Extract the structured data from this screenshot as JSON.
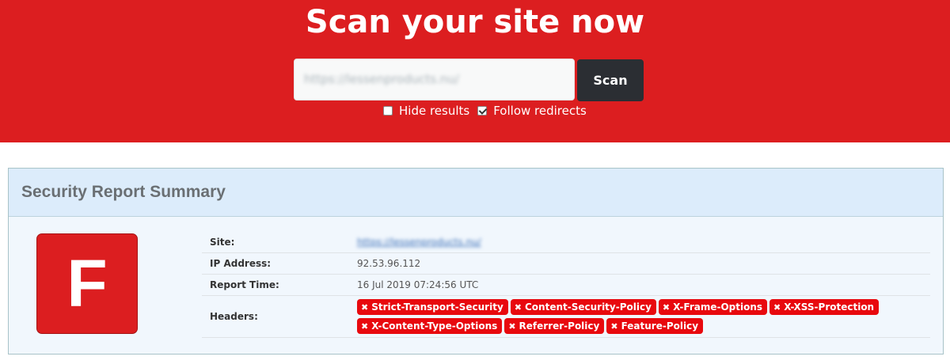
{
  "hero": {
    "title": "Scan your site now",
    "input_value": "https://lessenproducts.nu/",
    "scan_label": "Scan",
    "options": [
      {
        "label": "Hide results",
        "checked": false
      },
      {
        "label": "Follow redirects",
        "checked": true
      }
    ]
  },
  "report": {
    "title": "Security Report Summary",
    "grade": "F",
    "rows": {
      "site_label": "Site:",
      "site_value": "https://lessenproducts.nu/",
      "ip_label": "IP Address:",
      "ip_value": "92.53.96.112",
      "time_label": "Report Time:",
      "time_value": "16 Jul 2019 07:24:56 UTC",
      "headers_label": "Headers:"
    },
    "headers": [
      "Strict-Transport-Security",
      "Content-Security-Policy",
      "X-Frame-Options",
      "X-XSS-Protection",
      "X-Content-Type-Options",
      "Referrer-Policy",
      "Feature-Policy"
    ],
    "badge_icon": "✖"
  },
  "colors": {
    "hero_red": "#dc1e20",
    "scan_button": "#2b2e33",
    "badge_red": "#e8090e",
    "card_header": "#dcecfb",
    "card_body": "#f1f7fd"
  },
  "icons": {
    "badge": "x-mark-icon",
    "checkbox": "checkbox-icon"
  }
}
